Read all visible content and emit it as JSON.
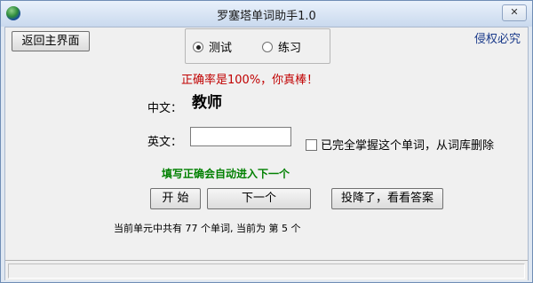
{
  "window": {
    "title": "罗塞塔单词助手1.0",
    "close_label": "✕"
  },
  "toolbar": {
    "back_label": "返回主界面",
    "copyright": "侵权必究"
  },
  "mode": {
    "options": [
      "测试",
      "练习"
    ],
    "selected": "测试"
  },
  "accuracy_text": "正确率是100%，你真棒！",
  "chinese": {
    "label": "中文：",
    "word": "教师"
  },
  "english": {
    "label": "英文：",
    "value": ""
  },
  "mastered_checkbox": {
    "label": "已完全掌握这个单词，从词库删除",
    "checked": false
  },
  "hint": "填写正确会自动进入下一个",
  "buttons": {
    "start": "开 始",
    "next": "下一个",
    "give_up": "投降了，看看答案"
  },
  "progress": {
    "prefix": "当前单元中共有",
    "total": "77",
    "middle": "个单词, 当前为",
    "di": "第",
    "current": "5",
    "suffix": "个"
  },
  "colors": {
    "accent_red": "#c00000",
    "hint_green": "#008000",
    "link_blue": "#1a3a8a"
  }
}
